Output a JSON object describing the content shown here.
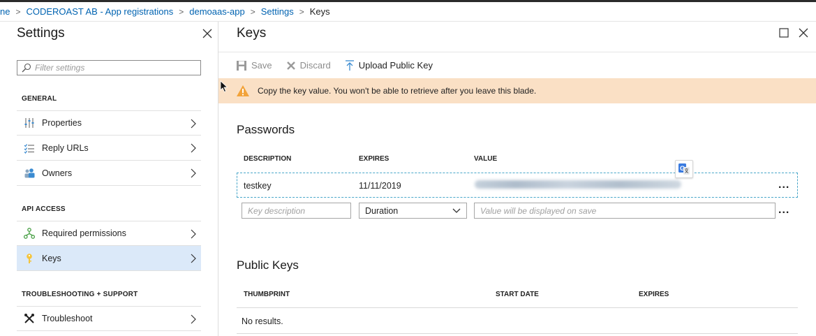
{
  "breadcrumb": {
    "items": [
      "ne",
      "CODEROAST AB - App registrations",
      "demoaas-app",
      "Settings"
    ],
    "current": "Keys",
    "separator": ">"
  },
  "settings_blade": {
    "title": "Settings",
    "filter_placeholder": "Filter settings",
    "sections": {
      "general": "GENERAL",
      "api_access": "API ACCESS",
      "troubleshooting": "TROUBLESHOOTING + SUPPORT"
    },
    "items": {
      "properties": "Properties",
      "reply_urls": "Reply URLs",
      "owners": "Owners",
      "required_permissions": "Required permissions",
      "keys": "Keys",
      "troubleshoot": "Troubleshoot"
    }
  },
  "keys_blade": {
    "title": "Keys",
    "toolbar": {
      "save": "Save",
      "discard": "Discard",
      "upload": "Upload Public Key"
    },
    "warning": "Copy the key value. You won't be able to retrieve after you leave this blade.",
    "passwords": {
      "title": "Passwords",
      "headers": {
        "description": "DESCRIPTION",
        "expires": "EXPIRES",
        "value": "VALUE"
      },
      "row": {
        "description": "testkey",
        "expires": "11/11/2019"
      },
      "new_row": {
        "description_placeholder": "Key description",
        "duration_selected": "Duration",
        "value_placeholder": "Value will be displayed on save"
      },
      "more": "..."
    },
    "public_keys": {
      "title": "Public Keys",
      "headers": {
        "thumbprint": "THUMBPRINT",
        "start_date": "START DATE",
        "expires": "EXPIRES"
      },
      "empty": "No results."
    }
  },
  "colors": {
    "link": "#0063b1",
    "active_item": "#dbe9f9",
    "warning_bg": "#fae0c5",
    "warning_icon": "#f2a33a",
    "icon_blue": "#3a8bd1",
    "icon_green": "#4aa047",
    "icon_yellow": "#f5c43a"
  },
  "icons": [
    "search-icon",
    "close-icon",
    "properties-icon",
    "reply-urls-icon",
    "owners-icon",
    "required-permissions-icon",
    "key-icon",
    "troubleshoot-icon",
    "chevron-right-icon",
    "save-icon",
    "discard-icon",
    "upload-icon",
    "warning-icon",
    "translate-icon",
    "chevron-down-icon",
    "maximize-icon"
  ]
}
